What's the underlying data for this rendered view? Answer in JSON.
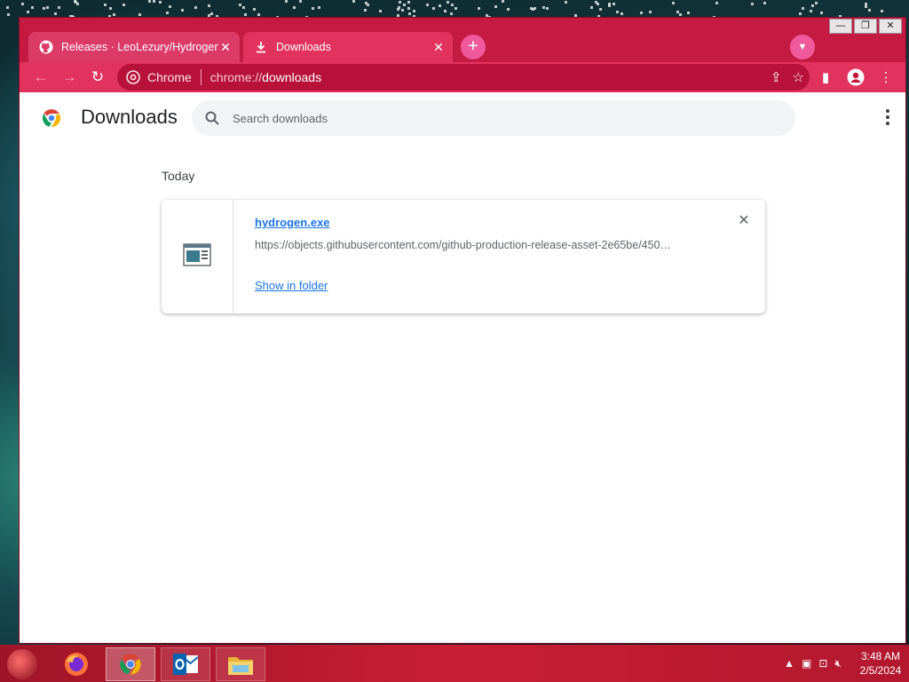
{
  "browser": {
    "tabs": [
      {
        "title": "Releases · LeoLezury/Hydrogen",
        "icon": "github-icon",
        "active": false
      },
      {
        "title": "Downloads",
        "icon": "download-icon",
        "active": true
      }
    ],
    "new_tab_label": "+",
    "omnibox": {
      "site_label": "Chrome",
      "url_scheme": "chrome://",
      "url_host": "downloads"
    },
    "window_controls": [
      "minimize",
      "restore",
      "close"
    ],
    "accent": "#e2335f"
  },
  "downloads_page": {
    "title": "Downloads",
    "search": {
      "placeholder": "Search downloads",
      "value": ""
    },
    "sections": [
      {
        "date": "Today",
        "items": [
          {
            "file_name": "hydrogen.exe",
            "url": "https://objects.githubusercontent.com/github-production-release-asset-2e65be/450…",
            "action": "Show in folder"
          }
        ]
      }
    ]
  },
  "taskbar": {
    "apps": [
      "firefox-icon",
      "chrome-icon",
      "outlook-icon",
      "file-explorer-icon"
    ],
    "clock": {
      "time": "3:48 AM",
      "date": "2/5/2024"
    }
  }
}
